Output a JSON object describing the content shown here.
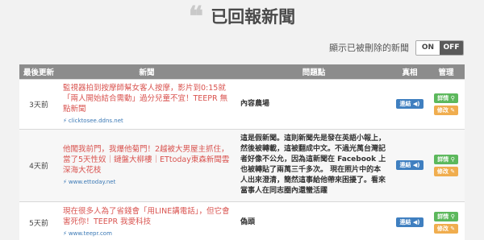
{
  "header": {
    "quote_mark": "❝",
    "title": "已回報新聞"
  },
  "toggle": {
    "label": "顯示已被刪除的新聞",
    "on_label": "ON",
    "off_label": "OFF",
    "selected": "OFF"
  },
  "table": {
    "columns": [
      "最後更新",
      "新聞",
      "問題點",
      "真相",
      "管理"
    ],
    "rows": [
      {
        "time": "3天前",
        "title": "監視器拍到按摩師幫女客人按摩，影片到0:15就「兩人開始結合需動」過分兒童不宜！TEEPR 無點新聞",
        "url": "clicktosee.ddns.net",
        "issue": "內容農場",
        "truth_btn": "連結",
        "detail_btn": "詳情",
        "edit_btn": "修改"
      },
      {
        "time": "4天前",
        "title": "他闖我前門，我爆他菊門！2越被大男屋主抓住，當了5天性奴｜鏈盤大柳樓｜ETtoday東森新聞雲深海大花枝",
        "url": "www.ettoday.net",
        "issue": "這是假新聞。這則新聞先是發在英語小報上，然後被轉載，這被翻成中文。不過光萬台灣記者好像不公允，因為這新聞在 Facebook 上也被轉貼了兩萬三千多次。 現在照片中的本人出來澄清，簡然這事給他帶來困擾了。看來當事人在同志圈內還蠻活躍",
        "truth_btn": "連結",
        "detail_btn": "詳情",
        "edit_btn": "修改"
      },
      {
        "time": "5天前",
        "title": "現在很多人為了省錢會「用LINE講電話」，但它會害死你！TEEPR 我愛科技",
        "url": "www.teepr.com",
        "issue": "偽頭",
        "truth_btn": "連結",
        "detail_btn": "詳情",
        "edit_btn": "修改"
      }
    ]
  },
  "colors": {
    "header_bg": "#8c8c8c",
    "title_red": "#d9534f",
    "url_blue": "#3a78b5",
    "btn_blue": "#3f7fc0",
    "btn_green": "#5cb85c",
    "btn_orange": "#f0ad4e"
  },
  "icons": {
    "link": "link-icon",
    "sound": "speaker-icon",
    "search": "search-icon",
    "pencil": "pencil-icon"
  }
}
